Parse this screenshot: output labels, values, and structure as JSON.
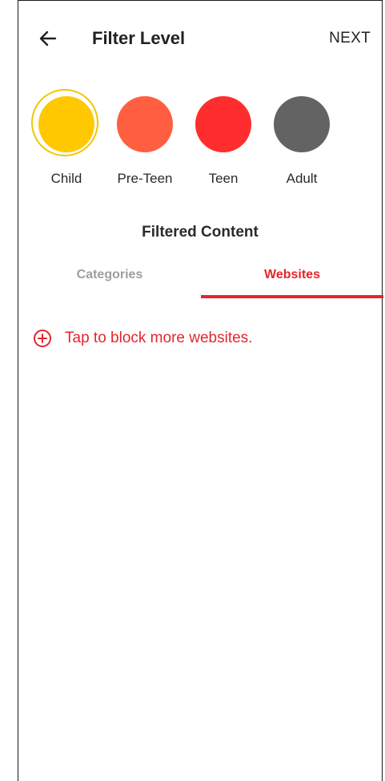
{
  "header": {
    "title": "Filter Level",
    "next_label": "NEXT",
    "back_icon": "arrow-left-icon"
  },
  "levels": [
    {
      "label": "Child",
      "color": "#ffc800",
      "selected": true
    },
    {
      "label": "Pre-Teen",
      "color": "#ff5f40",
      "selected": false
    },
    {
      "label": "Teen",
      "color": "#ff2d2d",
      "selected": false
    },
    {
      "label": "Adult",
      "color": "#636363",
      "selected": false
    }
  ],
  "section": {
    "title": "Filtered Content"
  },
  "tabs": [
    {
      "label": "Categories",
      "active": false
    },
    {
      "label": "Websites",
      "active": true
    }
  ],
  "websites": {
    "add_label": "Tap to block more websites.",
    "add_icon": "plus-circle-icon"
  },
  "colors": {
    "accent": "#e3262b",
    "selected_ring": "#f2c600",
    "text": "#222222",
    "inactive_tab": "#9e9e9e"
  }
}
